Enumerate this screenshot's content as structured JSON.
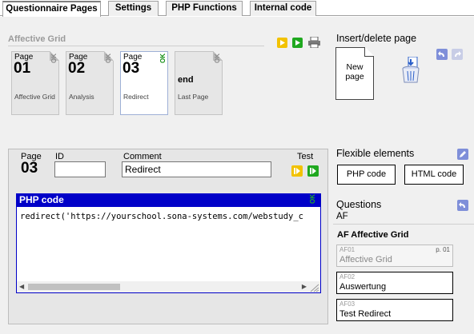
{
  "tabs": [
    {
      "label": "Questionnaire Pages",
      "active": true
    },
    {
      "label": "Settings",
      "active": false
    },
    {
      "label": "PHP Functions",
      "active": false
    },
    {
      "label": "Internal code",
      "active": false
    }
  ],
  "section": {
    "title": "Affective Grid"
  },
  "pages": [
    {
      "label": "Page",
      "number": "01",
      "name": "Affective Grid",
      "ok": "OK",
      "selected": false
    },
    {
      "label": "Page",
      "number": "02",
      "name": "Analysis",
      "ok": "OK",
      "selected": false
    },
    {
      "label": "Page",
      "number": "03",
      "name": "Redirect",
      "ok": "OK",
      "selected": true
    },
    {
      "label": "end",
      "number": "",
      "name": "Last Page",
      "ok": "OK",
      "selected": false
    }
  ],
  "insert_delete": {
    "title": "Insert/delete page",
    "new_page": "New page"
  },
  "editor": {
    "page_label": "Page",
    "page_number": "03",
    "id_label": "ID",
    "id_value": "",
    "comment_label": "Comment",
    "comment_value": "Redirect",
    "test_label": "Test",
    "code_title": "PHP code",
    "code_ok": "OK",
    "code_text": "redirect('https://yourschool.sona-systems.com/webstudy_c"
  },
  "flexible": {
    "title": "Flexible elements",
    "php_button": "PHP code",
    "html_button": "HTML code"
  },
  "questions": {
    "title": "Questions",
    "filter": "AF",
    "group_title": "AF Affective Grid",
    "items": [
      {
        "id": "AF01",
        "name": "Affective Grid",
        "page": "p. 01",
        "disabled": true
      },
      {
        "id": "AF02",
        "name": "Auswertung",
        "page": "",
        "disabled": false
      },
      {
        "id": "AF03",
        "name": "Test Redirect",
        "page": "",
        "disabled": false
      }
    ]
  },
  "colors": {
    "accent_blue": "#0000c8",
    "ok_green": "#0a8a0a",
    "icon_yellow": "#f2c200",
    "icon_green": "#1fa81f"
  }
}
